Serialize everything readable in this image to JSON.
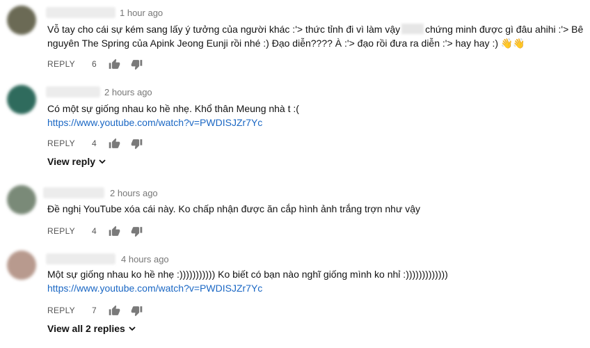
{
  "comments": [
    {
      "time": "1 hour ago",
      "line1_a": "Vỗ tay cho cái sự kém sang lấy ý tưởng của người khác :'> thức tỉnh đi vì làm vậy",
      "line1_b": "chứng minh được gì đâu ahihi :'> Bê",
      "line2": "nguyên The Spring của Apink Jeong Eunji rồi nhé :) Đạo diễn???? À :'> đạo rồi đưa ra diễn :'> hay hay :) 👋👋",
      "reply": "REPLY",
      "likes": "6",
      "avatar_color": "#6b6a55"
    },
    {
      "time": "2 hours ago",
      "line1": "Có một sự giống nhau ko hề nhẹ. Khổ thân Meung nhà t :(",
      "link": "https://www.youtube.com/watch?v=PWDISJZr7Yc",
      "reply": "REPLY",
      "likes": "4",
      "more": "View reply",
      "avatar_color": "#2f6b5d"
    },
    {
      "time": "2 hours ago",
      "line1": "Đề nghị YouTube xóa cái này. Ko chấp nhận được ăn cắp hình ảnh trắng trợn như vậy",
      "reply": "REPLY",
      "likes": "4",
      "avatar_color": "#7a8a78"
    },
    {
      "time": "4 hours ago",
      "line1": "Một sự giống nhau ko hề nhẹ :))))))))))) Ko biết có bạn nào nghĩ giống mình ko nhỉ :)))))))))))))",
      "link": "https://www.youtube.com/watch?v=PWDISJZr7Yc",
      "reply": "REPLY",
      "likes": "7",
      "more": "View all 2 replies",
      "avatar_color": "#b89a8e"
    }
  ]
}
